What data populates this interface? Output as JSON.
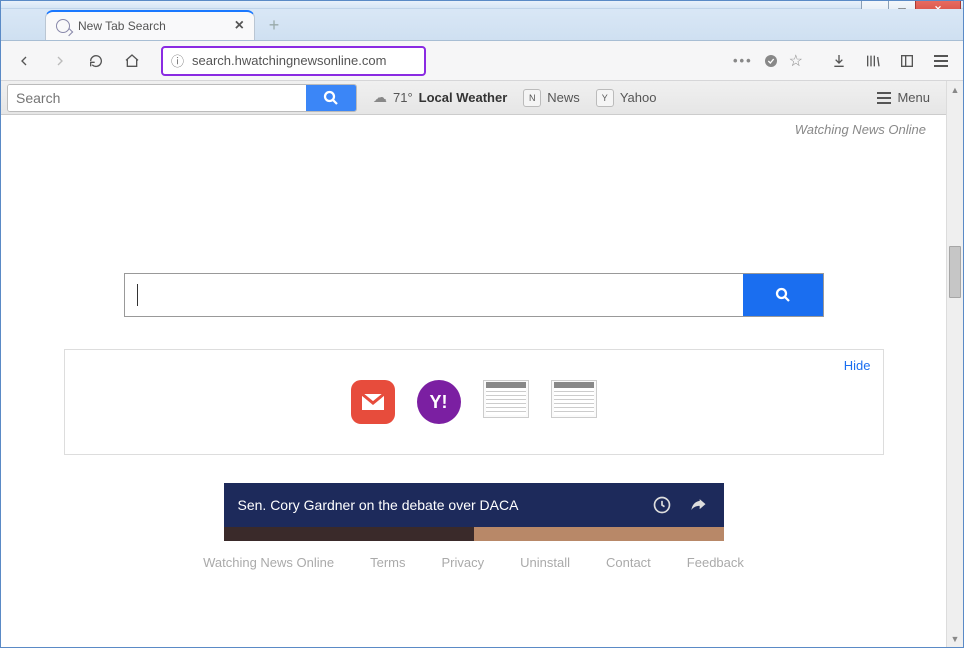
{
  "window": {
    "tab_title": "New Tab Search",
    "url": "search.hwatchingnewsonline.com"
  },
  "page_toolbar": {
    "search_placeholder": "Search",
    "weather_temp": "71°",
    "weather_label": "Local Weather",
    "news_label": "News",
    "yahoo_label": "Yahoo",
    "menu_label": "Menu"
  },
  "brand": "Watching News Online",
  "card": {
    "hide_label": "Hide",
    "icons": [
      "gmail",
      "yahoo",
      "paper1",
      "paper2"
    ]
  },
  "video": {
    "title": "Sen. Cory Gardner on the debate over DACA"
  },
  "footer": {
    "links": [
      "Watching News Online",
      "Terms",
      "Privacy",
      "Uninstall",
      "Contact",
      "Feedback"
    ]
  }
}
